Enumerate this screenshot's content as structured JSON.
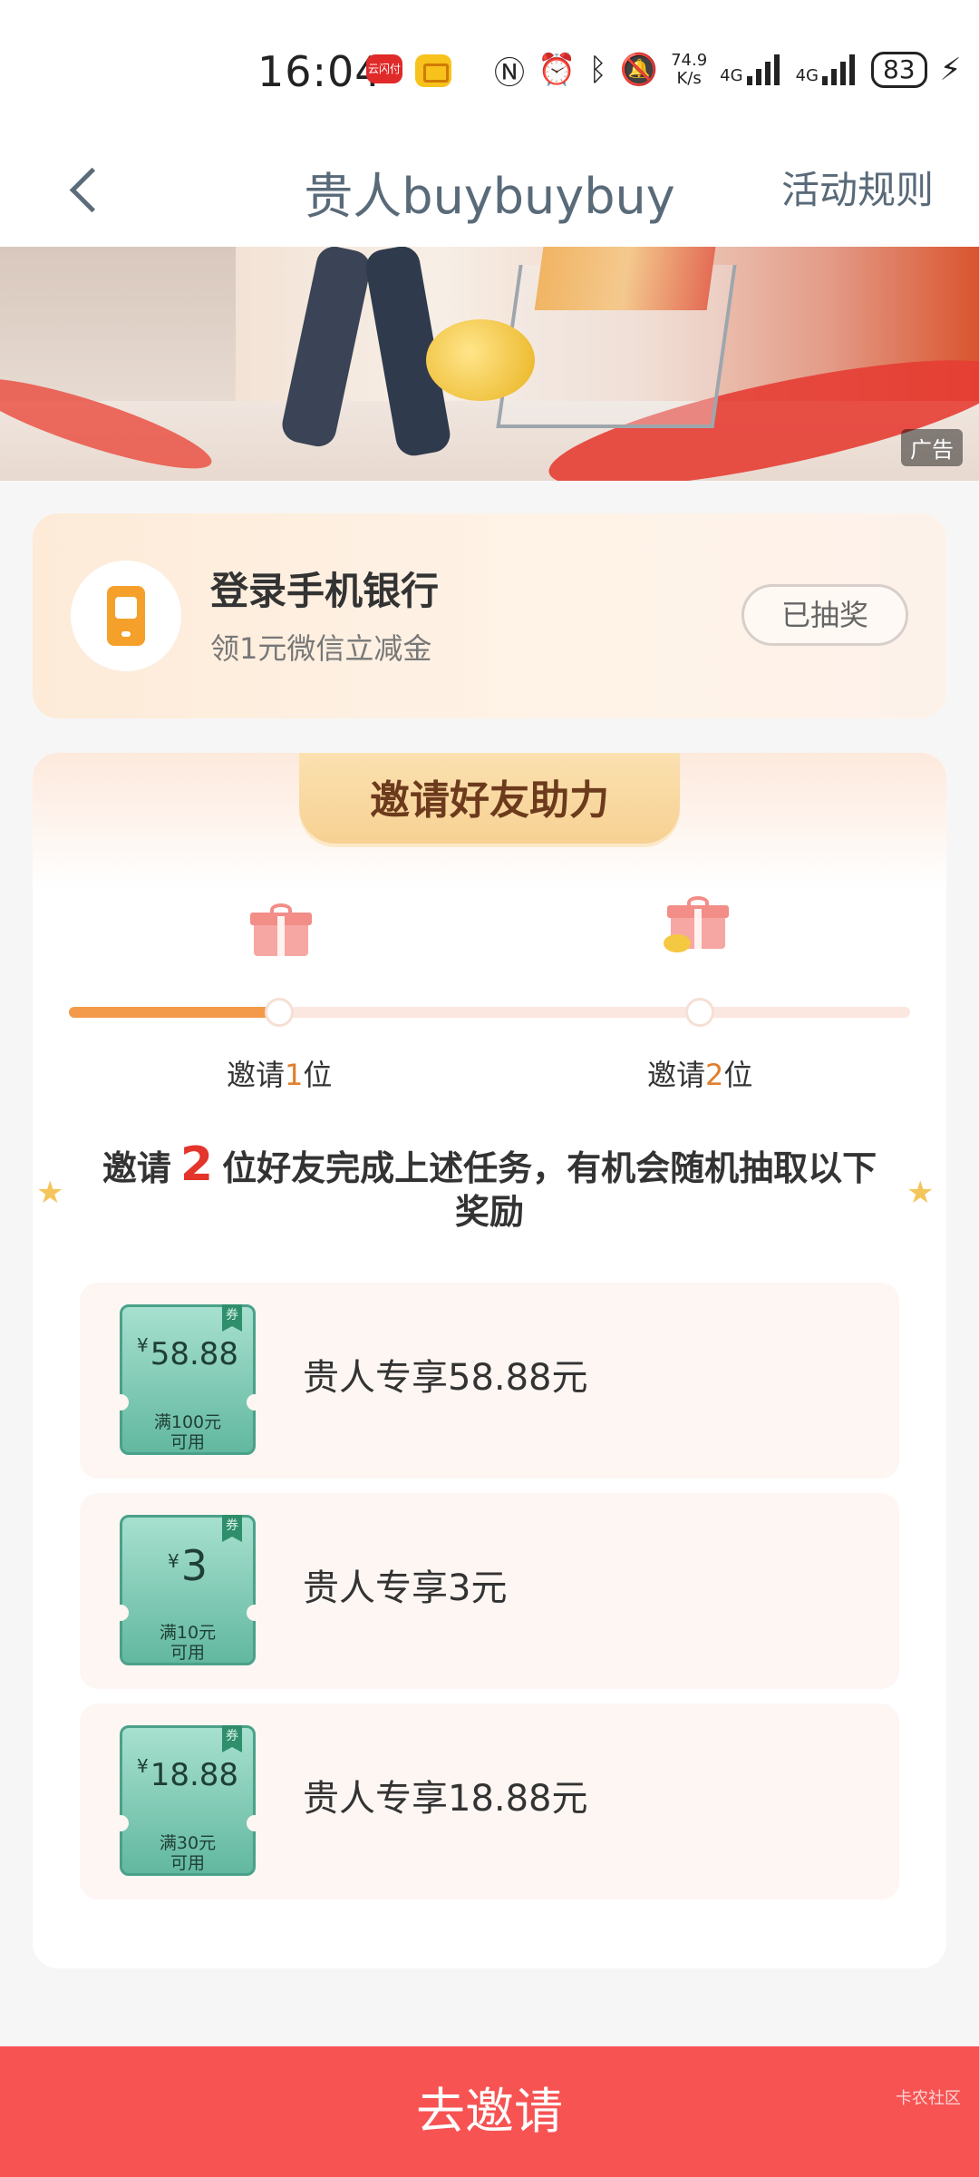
{
  "status_bar": {
    "time": "16:04",
    "app_badge": "云闪付",
    "net_speed_value": "74.9",
    "net_speed_unit": "K/s",
    "sim1": "4G",
    "sim2": "4G",
    "battery": "83",
    "icons": [
      "nfc-icon",
      "alarm-icon",
      "bluetooth-icon",
      "mute-icon",
      "charging-icon"
    ]
  },
  "nav": {
    "back_icon": "chevron-left-icon",
    "title": "贵人buybuybuy",
    "rules": "活动规则"
  },
  "banner": {
    "ad_label": "广告"
  },
  "task": {
    "icon": "phone-check-icon",
    "title": "登录手机银行",
    "subtitle": "领1元微信立减金",
    "button": "已抽奖"
  },
  "invite": {
    "header": "邀请好友助力",
    "progress": 0.25,
    "steps": [
      {
        "prefix": "邀请",
        "num": "1",
        "suffix": "位"
      },
      {
        "prefix": "邀请",
        "num": "2",
        "suffix": "位"
      }
    ],
    "desc_prefix": "邀请",
    "desc_num": "2",
    "desc_suffix": "位好友完成上述任务，有机会随机抽取以下奖励",
    "rewards": [
      {
        "currency": "¥",
        "amount": "58.88",
        "cond1": "满100元",
        "cond2": "可用",
        "flag": "券",
        "name": "贵人专享58.88元"
      },
      {
        "currency": "¥",
        "amount": "3",
        "cond1": "满10元",
        "cond2": "可用",
        "flag": "券",
        "name": "贵人专享3元"
      },
      {
        "currency": "¥",
        "amount": "18.88",
        "cond1": "满30元",
        "cond2": "可用",
        "flag": "券",
        "name": "贵人专享18.88元"
      }
    ]
  },
  "footer": {
    "button": "去邀请",
    "watermark": "卡农社区"
  },
  "colors": {
    "primary_button": "#f75353",
    "progress_fill": "#f39a4a",
    "coupon": "#62b89f",
    "highlight_number": "#e3352b"
  }
}
